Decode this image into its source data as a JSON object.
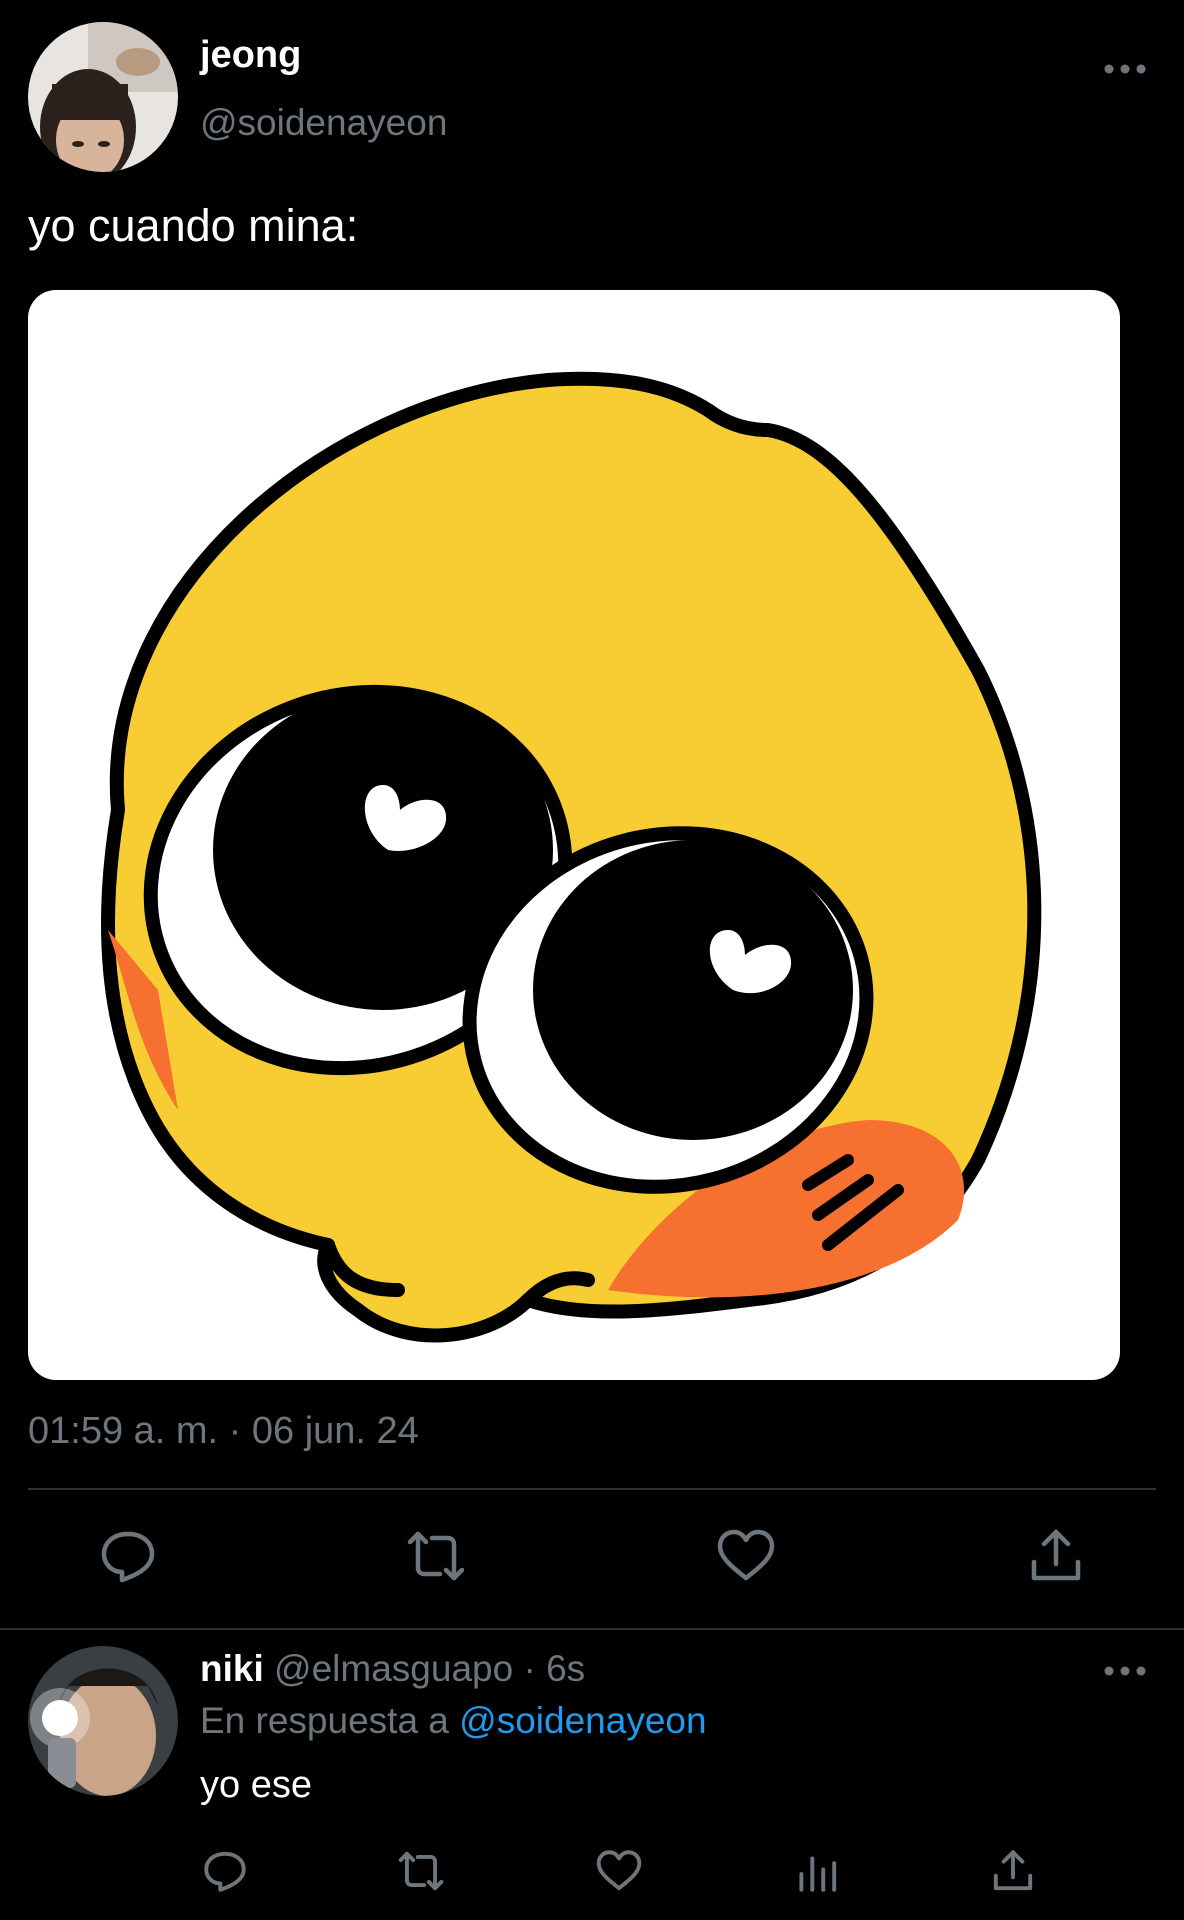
{
  "main_tweet": {
    "author_name": "jeong",
    "author_handle": "@soidenayeon",
    "text": "yo cuando mina:",
    "timestamp": "01:59 a. m. · 06 jun. 24",
    "image_icon": "pleading-face-emoji-drawing",
    "actions": [
      "reply-icon",
      "retweet-icon",
      "like-icon",
      "share-icon"
    ]
  },
  "reply_tweet": {
    "author_name": "niki",
    "author_handle": "@elmasguapo",
    "time_ago": "· 6s",
    "reply_prefix": "En respuesta a",
    "reply_mention": "@soidenayeon",
    "text": "yo ese",
    "actions": [
      "reply-icon",
      "retweet-icon",
      "like-icon",
      "analytics-icon",
      "share-icon"
    ]
  },
  "colors": {
    "background": "#000000",
    "secondary_text": "#6e767d",
    "link": "#1d9bf0",
    "divider": "#2f3336",
    "emoji_yellow": "#f8cd33",
    "emoji_blush": "#f6702f"
  }
}
